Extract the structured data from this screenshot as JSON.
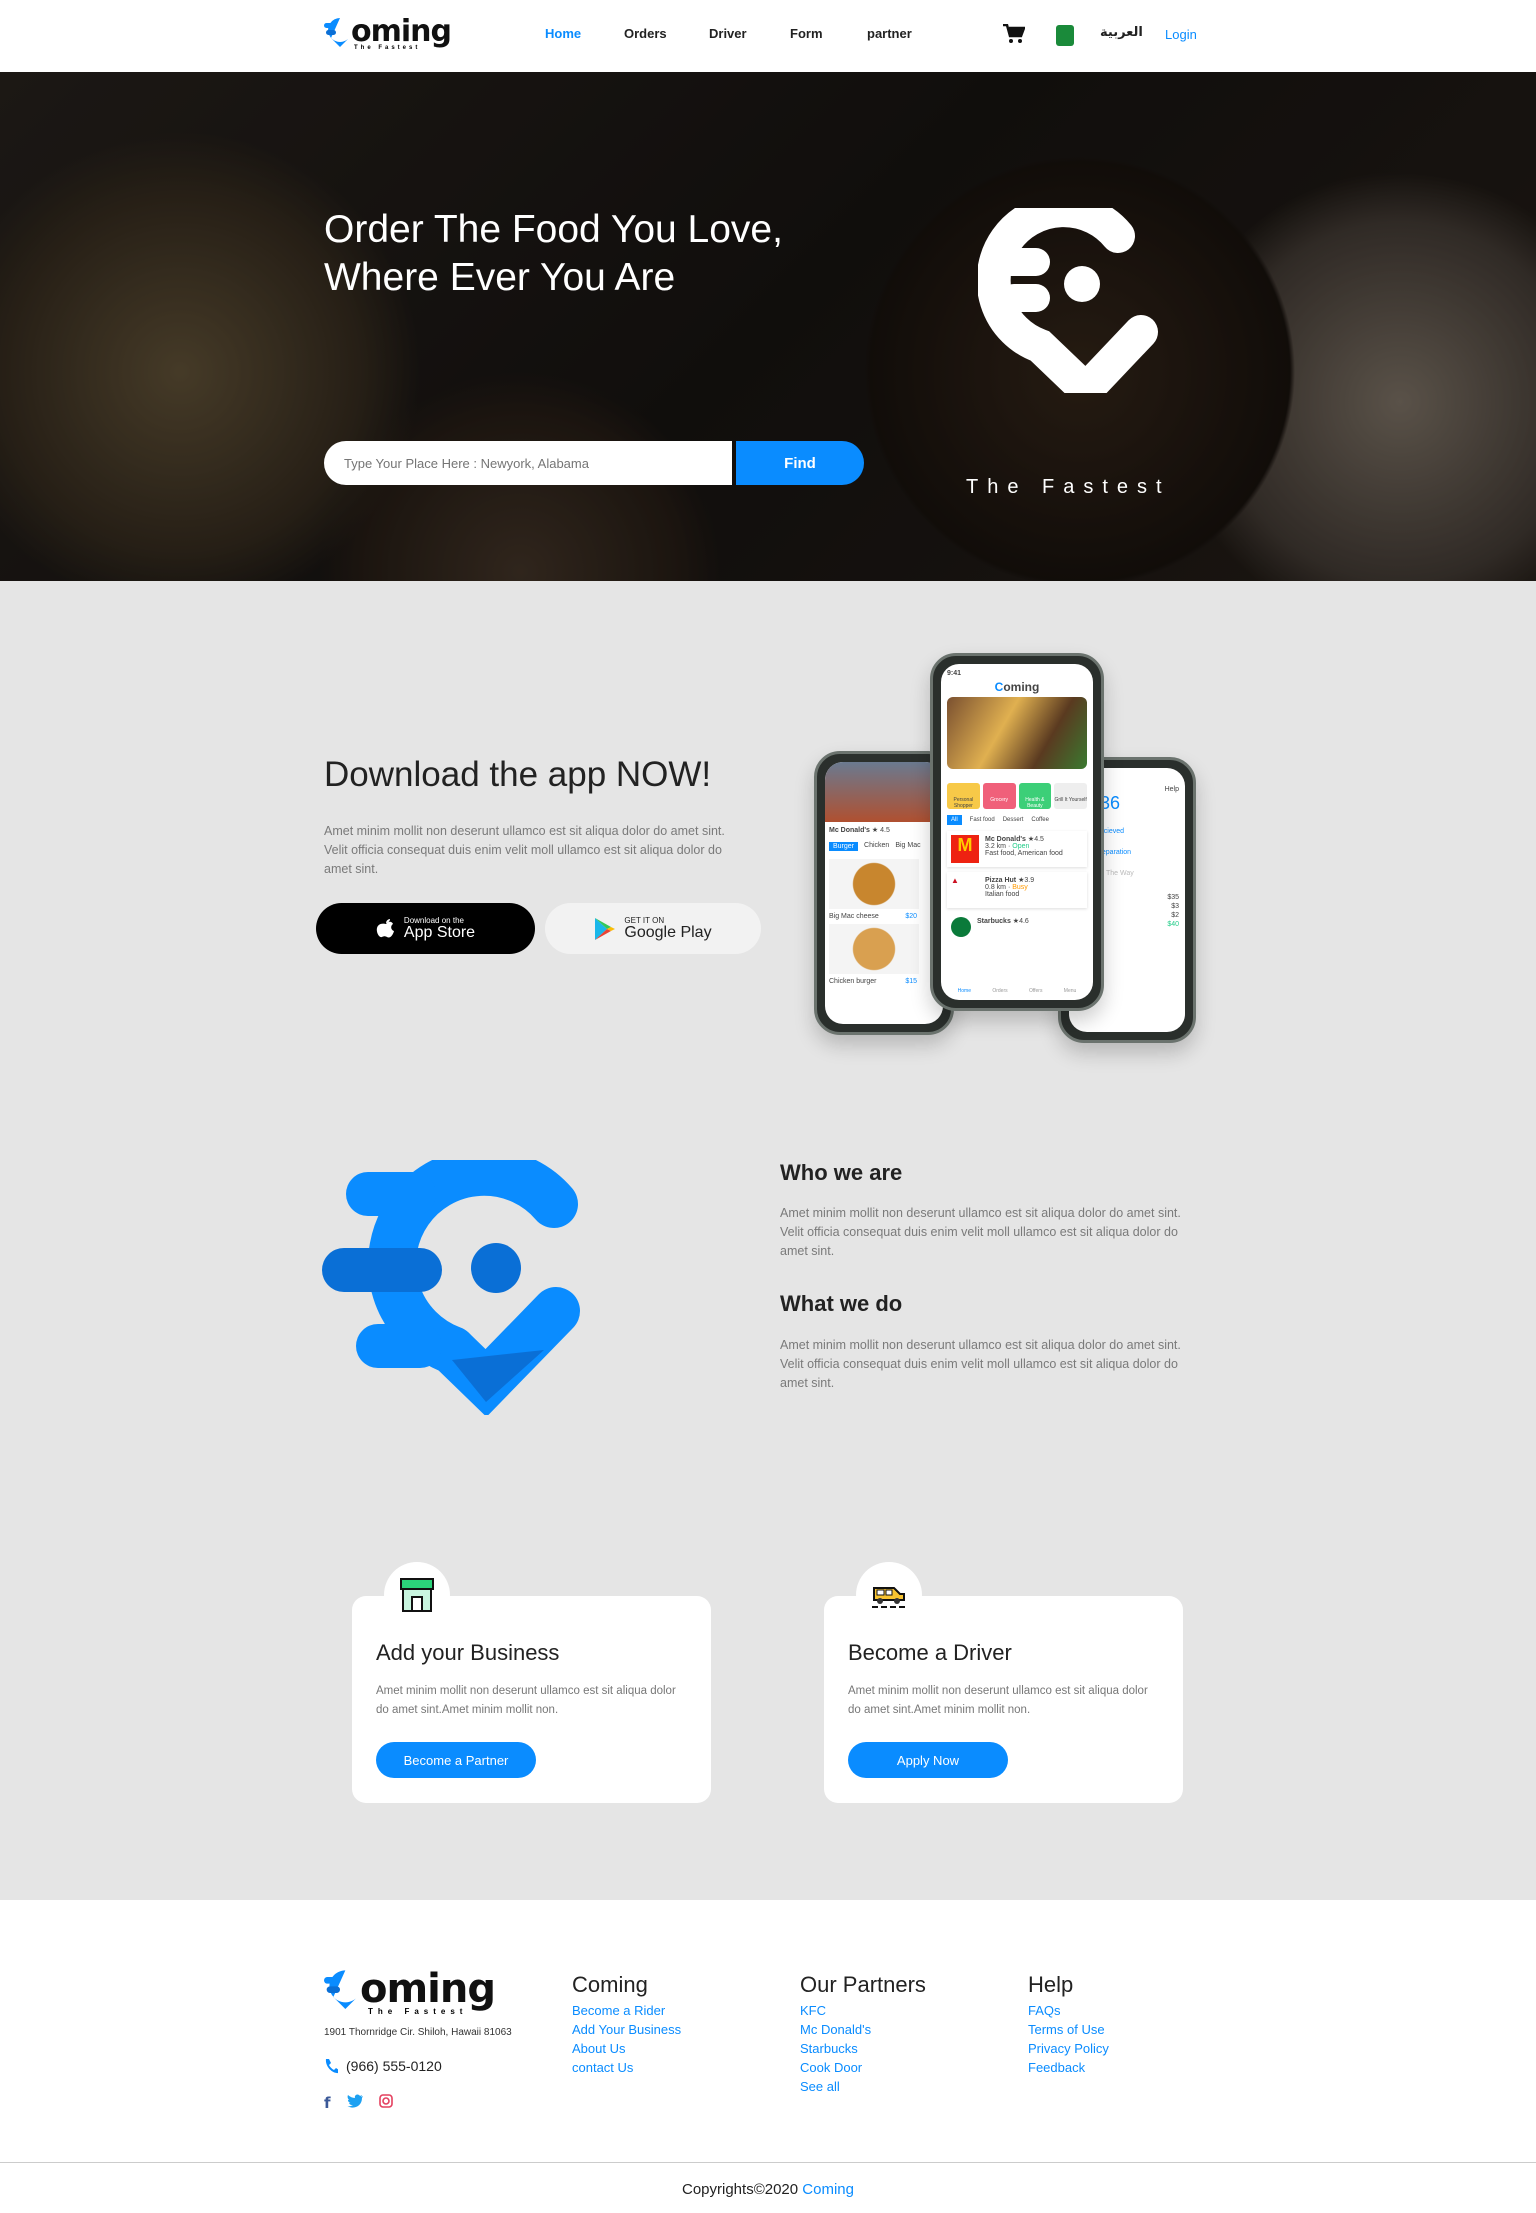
{
  "nav": {
    "logo": "oming",
    "logo_tagline": "The Fastest",
    "items": [
      "Home",
      "Orders",
      "Driver",
      "Form",
      "partner"
    ],
    "active": "Home",
    "language": "العربية",
    "login": "Login"
  },
  "hero": {
    "title_line1": "Order The Food You Love,",
    "title_line2": "Where Ever You Are",
    "search_placeholder": "Type Your Place Here : Newyork, Alabama",
    "find_label": "Find",
    "tagline": "The Fastest"
  },
  "download": {
    "title": "Download the app NOW!",
    "text": "Amet minim mollit non deserunt ullamco est sit aliqua dolor do amet sint. Velit officia consequat duis enim velit moll ullamco est sit aliqua dolor do amet sint.",
    "appstore_small": "Download on the",
    "appstore_big": "App Store",
    "google_small": "GET IT ON",
    "google_big": "Google Play"
  },
  "phone": {
    "time": "9:41",
    "logo": "oming",
    "categories": [
      "Personal Shopper",
      "Grocery",
      "Health & Beauty",
      "Grill It Yourself"
    ],
    "filters": [
      "All",
      "Fast food",
      "Dessert",
      "Coffee"
    ],
    "restaurants": [
      {
        "name": "Mc Donald's",
        "rating": "4.5",
        "distance": "3.2 km",
        "status": "Open",
        "type": "Fast food, American food"
      },
      {
        "name": "Pizza Hut",
        "rating": "3.9",
        "distance": "0.8 km",
        "status": "Busy",
        "type": "Italian food"
      },
      {
        "name": "Starbucks",
        "rating": "4.6"
      }
    ],
    "tabs": [
      "Home",
      "Orders",
      "Offers",
      "Menu"
    ],
    "left": {
      "restaurant": "Mc Donald's",
      "rating": "4.5",
      "chips": [
        "Burger",
        "Chicken",
        "Big Mac"
      ],
      "items": [
        {
          "name": "Big Mac cheese",
          "price": "$20"
        },
        {
          "name": "Chicken burger",
          "price": "$15"
        }
      ]
    },
    "right": {
      "help": "Help",
      "timer": "02:36",
      "steps": [
        "Order Recieved",
        "Order Preparation",
        "Order On The Way"
      ],
      "prices": [
        "$35",
        "$3",
        "$2",
        "$40"
      ],
      "method": "method"
    }
  },
  "about": {
    "who_title": "Who we are",
    "who_text": "Amet minim mollit non deserunt ullamco est sit aliqua dolor do amet sint. Velit officia consequat duis enim velit moll ullamco est sit aliqua dolor do amet sint.",
    "what_title": "What we do",
    "what_text": "Amet minim mollit non deserunt ullamco est sit aliqua dolor do amet sint. Velit officia consequat duis enim velit moll ullamco est sit aliqua dolor do amet sint."
  },
  "cards": [
    {
      "title": "Add your Business",
      "text": "Amet minim mollit non deserunt ullamco est sit aliqua dolor do amet sint.Amet minim mollit non.",
      "button": "Become a Partner",
      "icon": "store-icon"
    },
    {
      "title": "Become a Driver",
      "text": "Amet minim mollit non deserunt ullamco est sit aliqua dolor do amet sint.Amet minim mollit non.",
      "button": "Apply Now",
      "icon": "car-icon"
    }
  ],
  "footer": {
    "logo": "oming",
    "logo_tagline": "The Fastest",
    "address": "1901 Thornridge Cir. Shiloh, Hawaii 81063",
    "phone": "(966) 555-0120",
    "columns": [
      {
        "title": "Coming",
        "links": [
          "Become a Rider",
          "Add Your Business",
          "About Us",
          "contact Us"
        ]
      },
      {
        "title": "Our Partners",
        "links": [
          "KFC",
          "Mc Donald's",
          "Starbucks",
          "Cook Door",
          "See all"
        ]
      },
      {
        "title": "Help",
        "links": [
          "FAQs",
          "Terms of Use",
          "Privacy Policy",
          "Feedback"
        ]
      }
    ],
    "copyright": "Copyrights©2020",
    "copyright_brand": "Coming"
  },
  "colors": {
    "accent": "#0a8cff",
    "section_bg": "#e5e5e5"
  }
}
